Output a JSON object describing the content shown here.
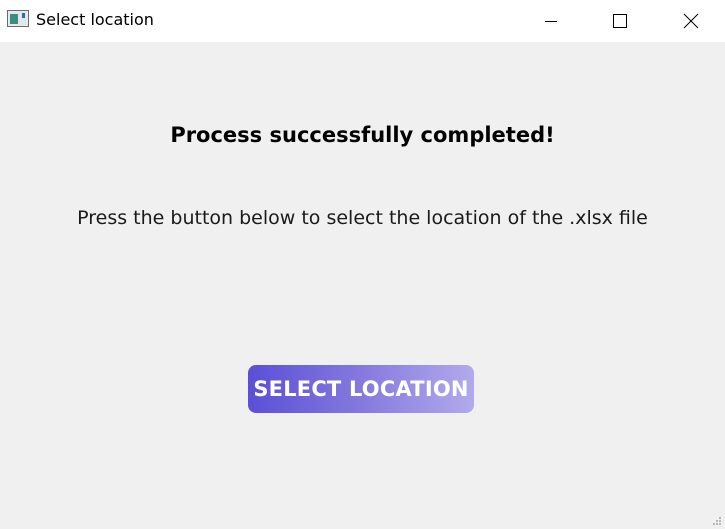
{
  "window": {
    "title": "Select location",
    "icon": "app-window-icon",
    "controls": {
      "minimize_icon": "minimize-icon",
      "maximize_icon": "maximize-icon",
      "close_icon": "close-icon"
    }
  },
  "content": {
    "heading": "Process successfully completed!",
    "instruction": "Press the button below to select the location of the .xlsx file",
    "button_label": "SELECT LOCATION"
  },
  "colors": {
    "background": "#f0f0f0",
    "titlebar": "#ffffff",
    "button_gradient_start": "#5a4fd6",
    "button_gradient_end": "#b2aaec",
    "button_text": "#ffffff"
  }
}
